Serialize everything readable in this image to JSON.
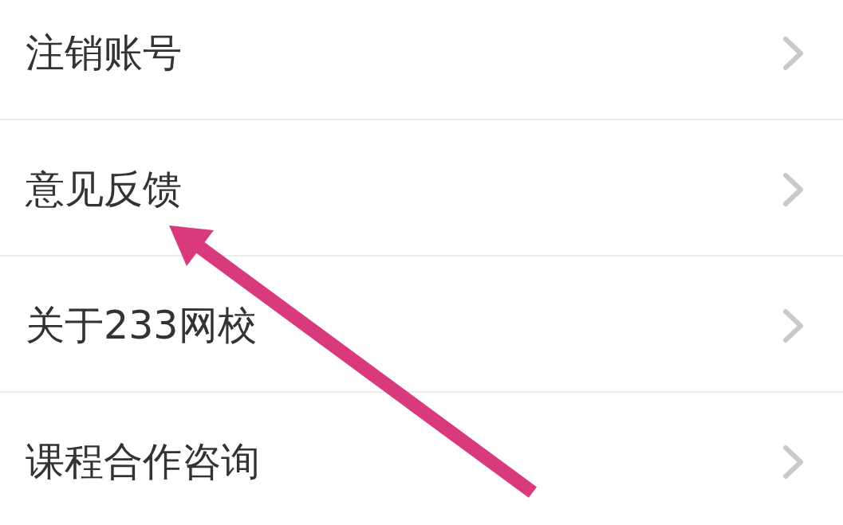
{
  "settings_list": {
    "items": [
      {
        "label": "注销账号"
      },
      {
        "label": "意见反馈"
      },
      {
        "label": "关于233网校"
      },
      {
        "label": "课程合作咨询"
      }
    ]
  }
}
